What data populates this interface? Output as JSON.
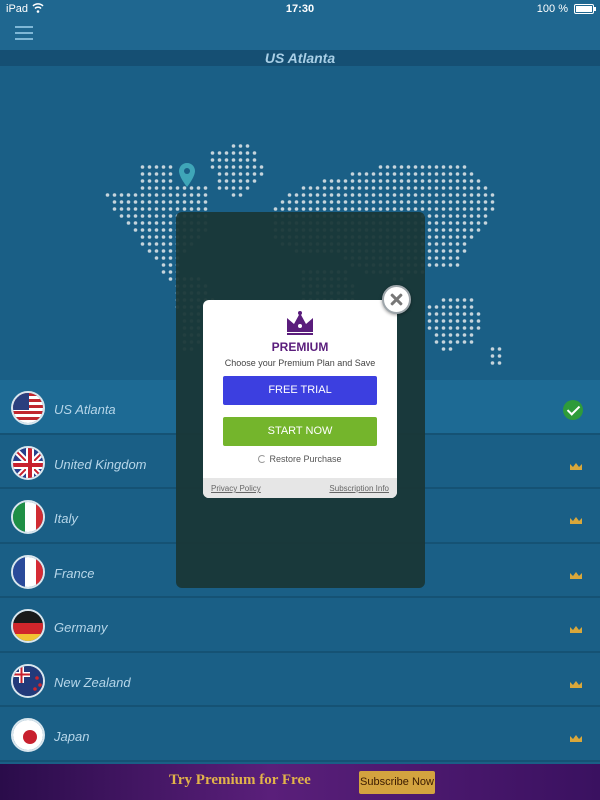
{
  "status_bar": {
    "device": "iPad",
    "time": "17:30",
    "battery": "100 %"
  },
  "header": {
    "location_title": "US Atlanta"
  },
  "countries": [
    {
      "name": "US Atlanta",
      "flag": "us-flag",
      "status": "connected"
    },
    {
      "name": "United Kingdom",
      "flag": "uk-flag",
      "status": "premium"
    },
    {
      "name": "Italy",
      "flag": "italy-flag",
      "status": "premium"
    },
    {
      "name": "France",
      "flag": "france-flag",
      "status": "premium"
    },
    {
      "name": "Germany",
      "flag": "germany-flag",
      "status": "premium"
    },
    {
      "name": "New Zealand",
      "flag": "new-zealand-flag",
      "status": "premium"
    },
    {
      "name": "Japan",
      "flag": "japan-flag",
      "status": "premium"
    }
  ],
  "modal": {
    "title": "PREMIUM",
    "subtitle": "Choose your Premium Plan and Save",
    "free_trial_label": "FREE TRIAL",
    "start_now_label": "START NOW",
    "restore_label": "Restore Purchase",
    "privacy_label": "Privacy Policy",
    "subscription_label": "Subscription Info"
  },
  "banner": {
    "text": "Try Premium for Free",
    "button_label": "Subscribe Now"
  },
  "colors": {
    "accent_purple": "#5a1d7c",
    "free_trial_blue": "#3c3fe0",
    "start_green": "#74b52c",
    "banner_gold": "#e2b34a"
  }
}
